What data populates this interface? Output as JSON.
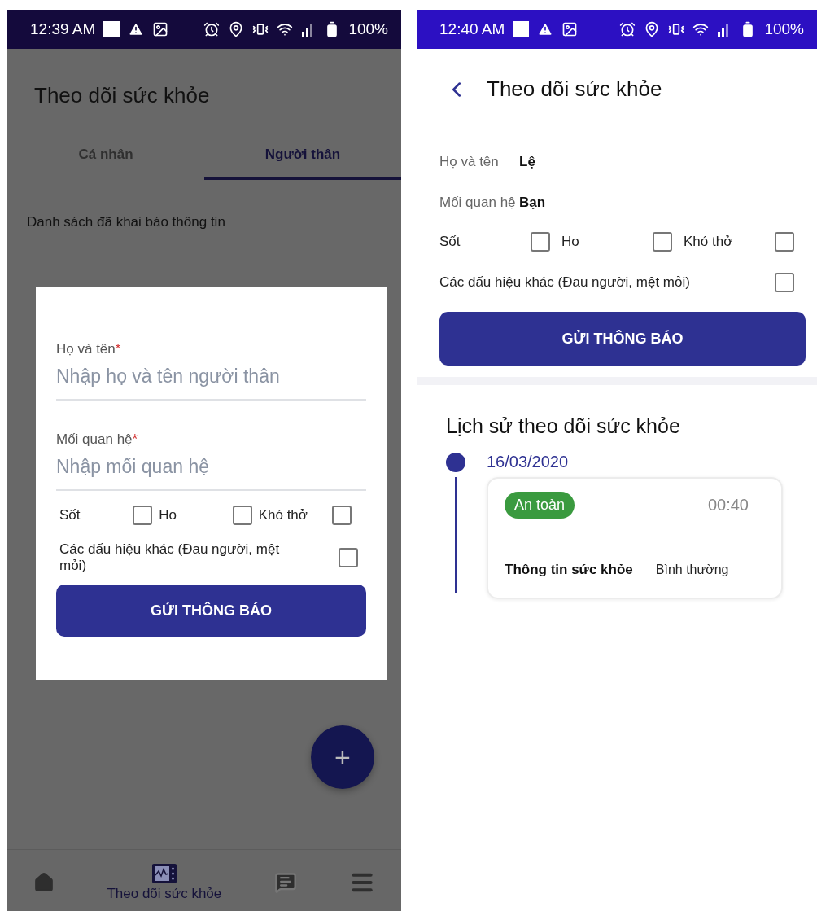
{
  "screens": [
    {
      "kind": "list",
      "status_bar": {
        "time": "12:39 AM",
        "battery": "100%"
      },
      "title": "Theo dõi sức khỏe",
      "tabs": [
        {
          "label": "Cá nhân",
          "selected": false
        },
        {
          "label": "Người thân",
          "selected": true
        }
      ],
      "section_label": "Danh sách đã khai báo thông tin",
      "dialog": {
        "fields": [
          {
            "label": "Họ và tên",
            "required_mark": "*",
            "placeholder": "Nhập họ và tên người thân"
          },
          {
            "label": "Mối quan hệ",
            "required_mark": "*",
            "placeholder": "Nhập mối quan hệ"
          }
        ],
        "symptoms": [
          {
            "label": "Sốt",
            "checked": false
          },
          {
            "label": "Ho",
            "checked": false
          },
          {
            "label": "Khó thở",
            "checked": false
          }
        ],
        "other_symptoms": {
          "label": "Các dấu hiệu khác (Đau người, mệt mỏi)",
          "checked": false
        },
        "submit": "GỬI THÔNG BÁO"
      },
      "fab": "+",
      "bottom_nav": [
        {
          "kind": "home",
          "selected": false
        },
        {
          "kind": "health",
          "label": "Theo dõi sức khỏe",
          "selected": true
        },
        {
          "kind": "chat",
          "selected": false
        },
        {
          "kind": "menu",
          "selected": false
        }
      ]
    },
    {
      "kind": "detail",
      "status_bar": {
        "time": "12:40 AM",
        "battery": "100%"
      },
      "title": "Theo dõi sức khỏe",
      "info": [
        {
          "label": "Họ và tên",
          "value": "Lệ"
        },
        {
          "label": "Mối quan hệ",
          "value": "Bạn"
        }
      ],
      "symptoms": [
        {
          "label": "Sốt",
          "checked": false
        },
        {
          "label": "Ho",
          "checked": false
        },
        {
          "label": "Khó thở",
          "checked": false
        }
      ],
      "other_symptoms": {
        "label": "Các dấu hiệu khác (Đau người, mệt mỏi)",
        "checked": false
      },
      "submit": "GỬI THÔNG BÁO",
      "history": {
        "title": "Lịch sử theo dõi sức khỏe",
        "entries": [
          {
            "date": "16/03/2020",
            "status": "An toàn",
            "color": "#3a9a3f",
            "time": "00:40",
            "info_label": "Thông tin sức khỏe",
            "info_value": "Bình thường"
          }
        ]
      }
    }
  ]
}
